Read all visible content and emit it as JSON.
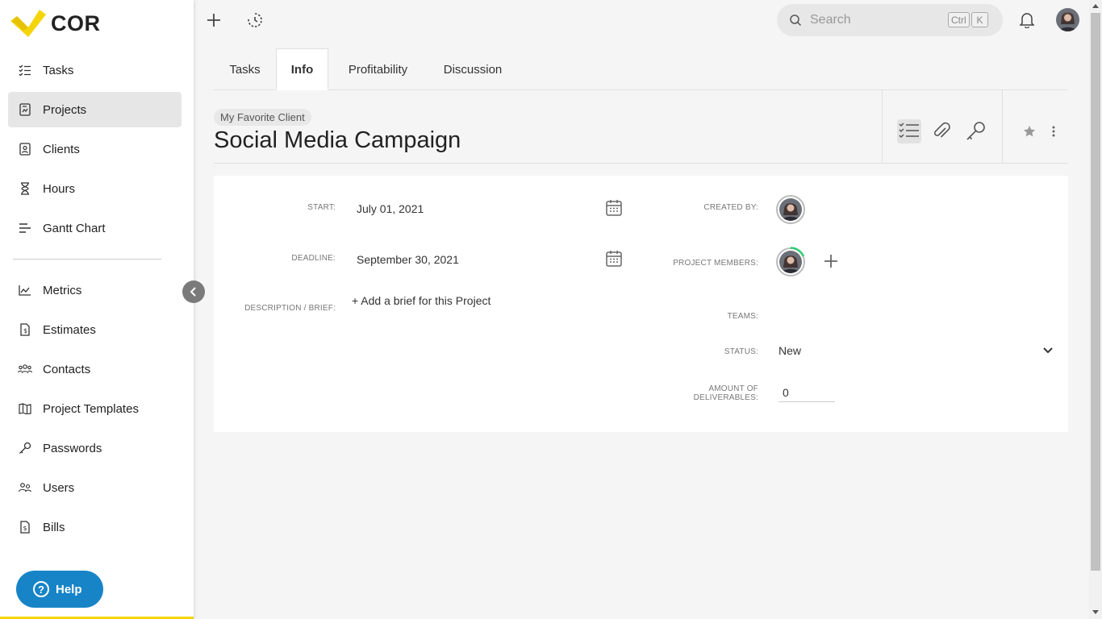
{
  "brand": {
    "name": "COR"
  },
  "sidebar": {
    "items": [
      {
        "label": "Tasks",
        "icon": "tasks-icon"
      },
      {
        "label": "Projects",
        "icon": "projects-icon",
        "active": true
      },
      {
        "label": "Clients",
        "icon": "clients-icon"
      },
      {
        "label": "Hours",
        "icon": "hourglass-icon"
      },
      {
        "label": "Gantt Chart",
        "icon": "gantt-icon"
      },
      {
        "label": "Metrics",
        "icon": "metrics-icon"
      },
      {
        "label": "Estimates",
        "icon": "estimates-icon"
      },
      {
        "label": "Contacts",
        "icon": "contacts-icon"
      },
      {
        "label": "Project Templates",
        "icon": "templates-icon"
      },
      {
        "label": "Passwords",
        "icon": "key-icon"
      },
      {
        "label": "Users",
        "icon": "users-icon"
      },
      {
        "label": "Bills",
        "icon": "bills-icon"
      }
    ],
    "help_label": "Help"
  },
  "topbar": {
    "search_placeholder": "Search",
    "shortcut_ctrl": "Ctrl",
    "shortcut_key": "K"
  },
  "tabs": [
    {
      "label": "Tasks"
    },
    {
      "label": "Info",
      "active": true
    },
    {
      "label": "Profitability"
    },
    {
      "label": "Discussion"
    }
  ],
  "project": {
    "client": "My Favorite Client",
    "title": "Social Media Campaign"
  },
  "info": {
    "start_label": "START:",
    "start_value": "July 01, 2021",
    "deadline_label": "DEADLINE:",
    "deadline_value": "September 30, 2021",
    "description_label": "DESCRIPTION / BRIEF:",
    "description_action": "+ Add a brief for this Project",
    "created_by_label": "CREATED BY:",
    "members_label": "PROJECT MEMBERS:",
    "teams_label": "TEAMS:",
    "status_label": "STATUS:",
    "status_value": "New",
    "deliverables_label_1": "AMOUNT OF",
    "deliverables_label_2": "DELIVERABLES:",
    "deliverables_value": "0"
  },
  "colors": {
    "brand_yellow": "#f5d50a",
    "help_blue": "#1784c7",
    "progress_green": "#2ecc71"
  }
}
